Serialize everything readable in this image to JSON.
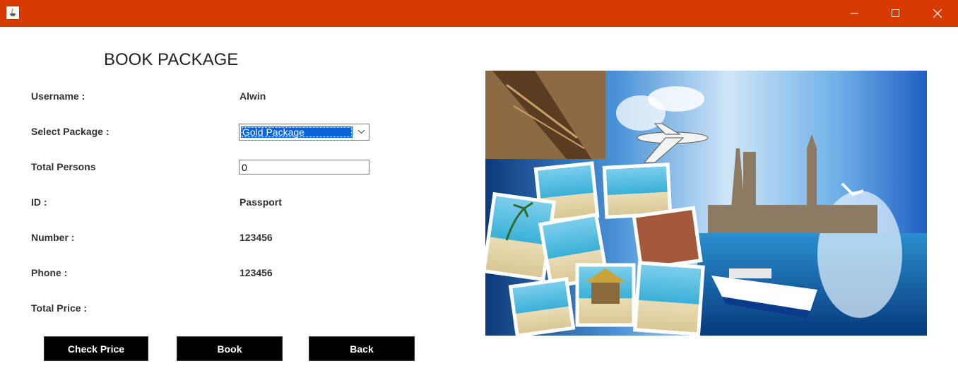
{
  "window": {
    "app_icon": "java-app-icon",
    "controls": [
      "minimize-icon",
      "maximize-icon",
      "close-icon"
    ],
    "accent": "#d83a02"
  },
  "form": {
    "heading": "BOOK PACKAGE",
    "username_label": "Username :",
    "username_value": "Alwin",
    "package_label": "Select Package :",
    "package_selected": "Gold Package",
    "persons_label": "Total Persons",
    "persons_value": "0",
    "id_label": "ID :",
    "id_value": "Passport",
    "number_label": "Number :",
    "number_value": "123456",
    "phone_label": "Phone :",
    "phone_value": "123456",
    "price_label": "Total Price :",
    "price_value": ""
  },
  "buttons": {
    "check_price": "Check Price",
    "book": "Book",
    "back": "Back"
  },
  "image": {
    "subject": "travel-collage-illustration"
  }
}
